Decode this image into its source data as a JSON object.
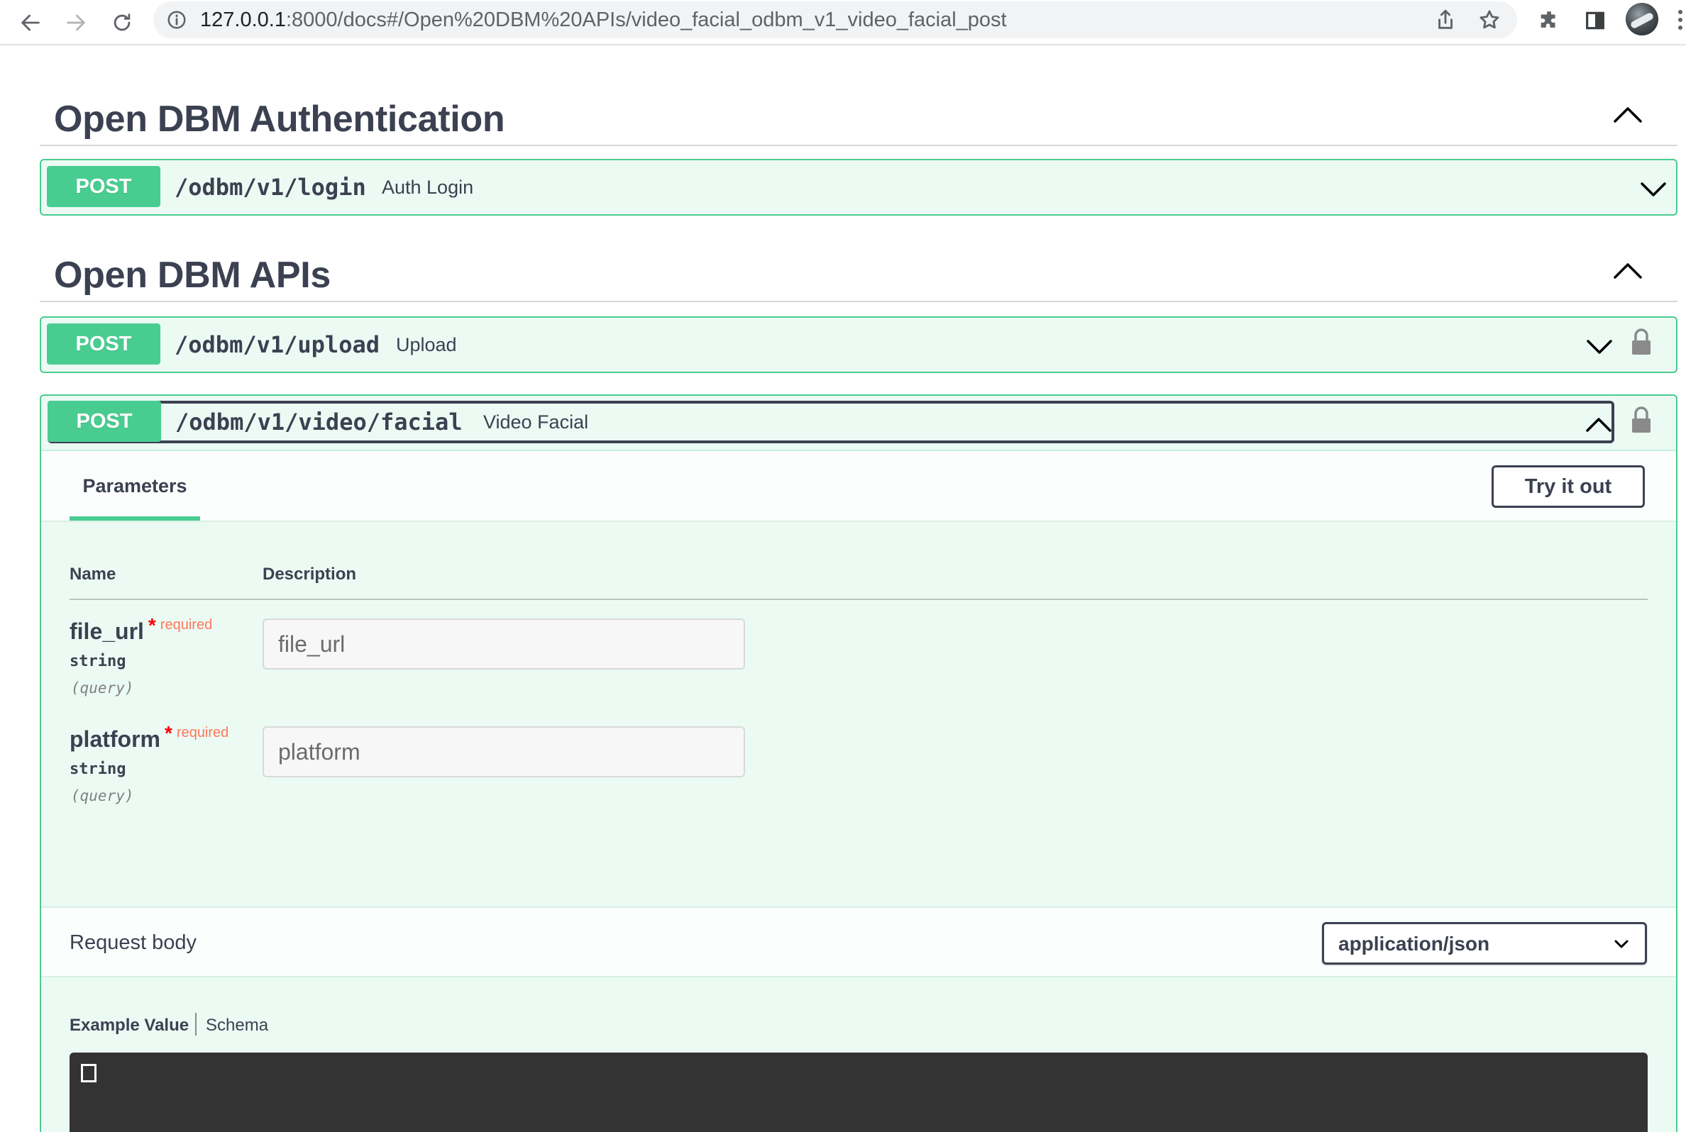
{
  "browser": {
    "url_host": "127.0.0.1",
    "url_rest": ":8000/docs#/Open%20DBM%20APIs/video_facial_odbm_v1_video_facial_post",
    "icons": [
      "back-arrow-icon",
      "forward-arrow-icon",
      "reload-icon",
      "info-icon",
      "share-icon",
      "star-icon",
      "extensions-icon",
      "side-panel-icon",
      "profile-avatar",
      "kebab-menu-icon"
    ]
  },
  "sections": [
    {
      "title": "Open DBM Authentication",
      "operations": [
        {
          "method": "POST",
          "path": "/odbm/v1/login",
          "summary": "Auth Login",
          "locked": false,
          "expanded": false
        }
      ]
    },
    {
      "title": "Open DBM APIs",
      "operations": [
        {
          "method": "POST",
          "path": "/odbm/v1/upload",
          "summary": "Upload",
          "locked": true,
          "expanded": false
        },
        {
          "method": "POST",
          "path": "/odbm/v1/video/facial",
          "summary": "Video Facial",
          "locked": true,
          "expanded": true
        }
      ]
    }
  ],
  "facial": {
    "tab_label": "Parameters",
    "try_label": "Try it out",
    "col_name": "Name",
    "col_description": "Description",
    "params": [
      {
        "name": "file_url",
        "star": "*",
        "required": "required",
        "type": "string",
        "in": "(query)",
        "placeholder": "file_url"
      },
      {
        "name": "platform",
        "star": "*",
        "required": "required",
        "type": "string",
        "in": "(query)",
        "placeholder": "platform"
      }
    ],
    "request_body_label": "Request body",
    "content_type": "application/json",
    "example_tab": "Example Value",
    "schema_tab": "Schema"
  },
  "colors": {
    "post_green": "#49cc90",
    "text_dark": "#3b4151",
    "required_red": "#ff0000",
    "code_bg": "#333333"
  }
}
